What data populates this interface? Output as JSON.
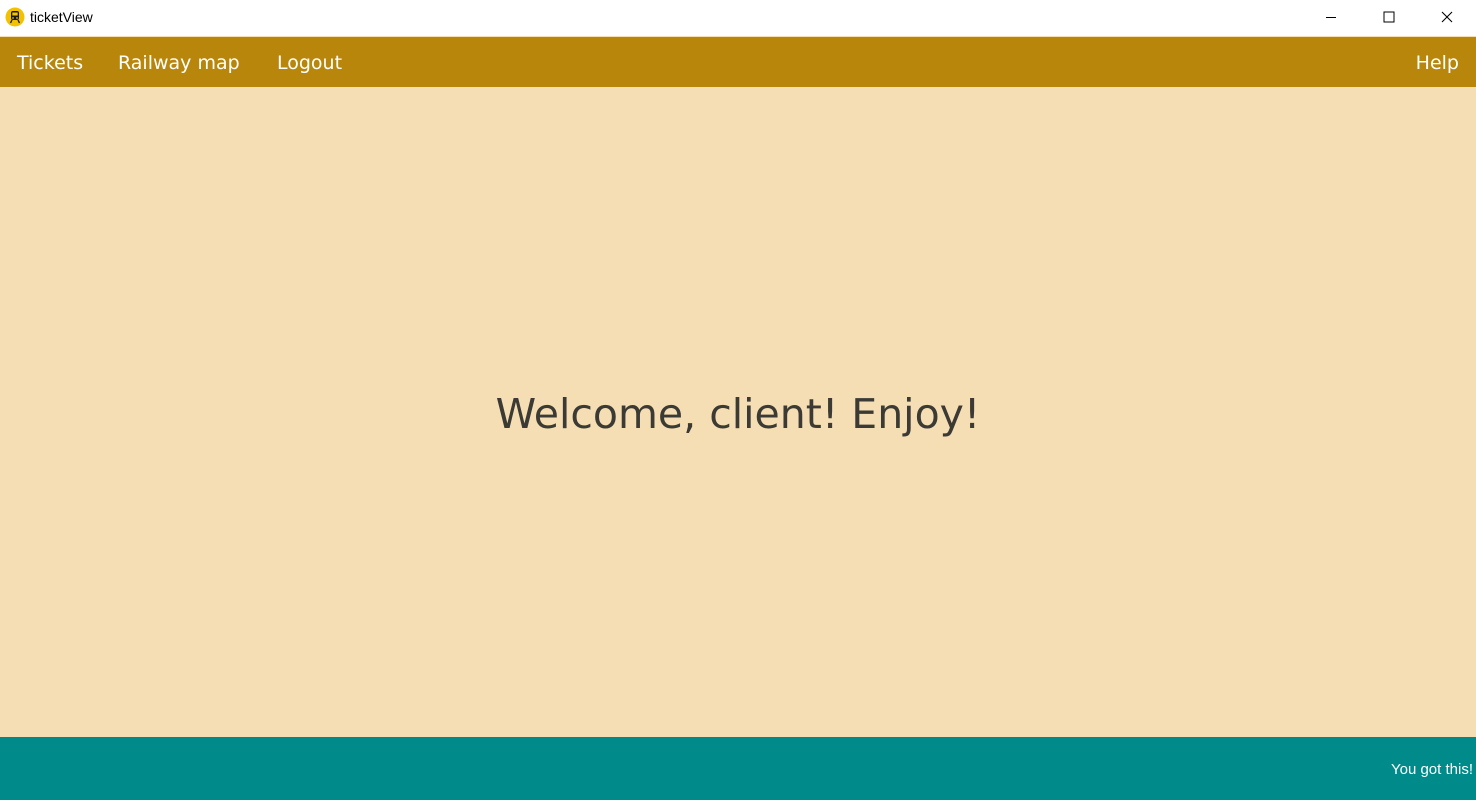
{
  "window": {
    "title": "ticketView",
    "app_icon": "train-icon",
    "controls": {
      "minimize": "minimize-icon",
      "maximize": "maximize-icon",
      "close": "close-icon"
    }
  },
  "navbar": {
    "items": [
      {
        "label": "Tickets"
      },
      {
        "label": "Railway map"
      },
      {
        "label": "Logout"
      }
    ],
    "help_label": "Help"
  },
  "main": {
    "welcome_text": "Welcome, client! Enjoy!"
  },
  "footer": {
    "text": "You got this!"
  },
  "colors": {
    "navbar": "#b8860b",
    "background": "#f5deb3",
    "footer": "#008b8b",
    "text": "#3c3a34"
  }
}
